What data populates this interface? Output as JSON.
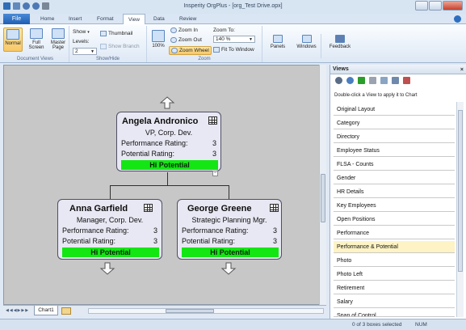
{
  "window": {
    "title": "Insperity OrgPlus - [org_Test Drive.opx]"
  },
  "menu": {
    "file": "File",
    "tabs": [
      "Home",
      "Insert",
      "Format",
      "View",
      "Data",
      "Review"
    ],
    "active": "View"
  },
  "ribbon": {
    "doc_views": {
      "normal": "Normal",
      "full_screen": "Full Screen",
      "master_page": "Master Page",
      "label": "Document Views"
    },
    "show_hide": {
      "show": "Show",
      "levels": "Levels:",
      "levels_value": "2",
      "thumbnail": "Thumbnail",
      "show_branch": "Show Branch",
      "label": "Show/Hide"
    },
    "zoom": {
      "percent": "100%",
      "zoom_in": "Zoom In",
      "zoom_out": "Zoom Out",
      "zoom_wheel": "Zoom Wheel",
      "zoom_to": "Zoom To:",
      "zoom_value": "140 %",
      "fit_to_window": "Fit To Window",
      "label": "Zoom"
    },
    "panels": "Panels",
    "windows": "Windows",
    "feedback": "Feedback"
  },
  "chart": {
    "root": {
      "name": "Angela Andronico",
      "title": "VP, Corp. Dev.",
      "perf_label": "Performance Rating:",
      "perf": "3",
      "pot_label": "Potential Rating:",
      "pot": "3",
      "badge": "Hi Potential",
      "collapse": "−"
    },
    "children": [
      {
        "name": "Anna Garfield",
        "title": "Manager, Corp. Dev.",
        "perf_label": "Performance Rating:",
        "perf": "3",
        "pot_label": "Potential Rating:",
        "pot": "3",
        "badge": "Hi Potential"
      },
      {
        "name": "George Greene",
        "title": "Strategic Planning Mgr.",
        "perf_label": "Performance Rating:",
        "perf": "3",
        "pot_label": "Potential Rating:",
        "pot": "3",
        "badge": "Hi Potential"
      }
    ]
  },
  "sheet": {
    "tab": "Chart1"
  },
  "views_panel": {
    "title": "Views",
    "close": "×",
    "hint": "Double-click a View to apply it to Chart",
    "items": [
      "Original Layout",
      "Category",
      "Directory",
      "Employee Status",
      "FLSA - Counts",
      "Gender",
      "HR Details",
      "Key Employees",
      "Open Positions",
      "Performance",
      "Performance & Potential",
      "Photo",
      "Photo Left",
      "Retirement",
      "Salary",
      "Span of Control"
    ],
    "selected": "Performance & Potential"
  },
  "status": {
    "boxes": "0 of 3 boxes selected",
    "num": "NUM"
  },
  "colors": {
    "badge": "#14e614",
    "card": "#e8e8f4",
    "selected_view": "#fdf3c4",
    "file_tab": "#1f5fb4"
  }
}
